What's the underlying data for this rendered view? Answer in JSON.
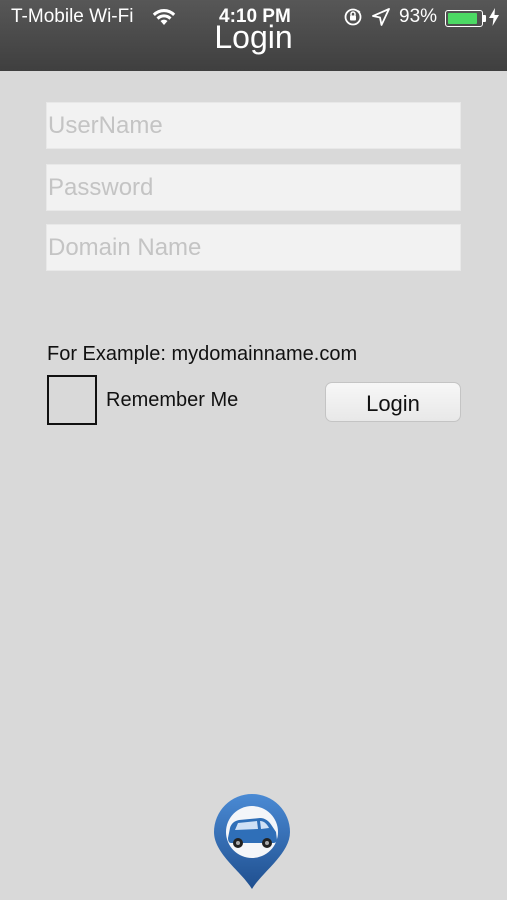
{
  "status_bar": {
    "carrier": "T-Mobile Wi-Fi",
    "time": "4:10 PM",
    "battery": "93%",
    "battery_level": 0.93,
    "icons": [
      "wifi-icon",
      "orientation-lock-icon",
      "location-arrow-icon",
      "battery-icon",
      "charging-bolt-icon"
    ]
  },
  "nav": {
    "title": "Login"
  },
  "form": {
    "username_placeholder": "UserName",
    "password_placeholder": "Password",
    "domain_placeholder": "Domain Name",
    "example_text": "For Example: mydomainname.com",
    "remember_label": "Remember Me",
    "remember_checked": false,
    "login_label": "Login"
  },
  "logo": {
    "icon": "car-location-pin-logo",
    "colors": {
      "pin": "#3a78c2",
      "pin_dark": "#1f4f8f",
      "car": "#2f6fb8"
    }
  },
  "colors": {
    "background": "#d9d9d9",
    "topbar": "#4a4a4a",
    "battery_green": "#4cd964"
  }
}
